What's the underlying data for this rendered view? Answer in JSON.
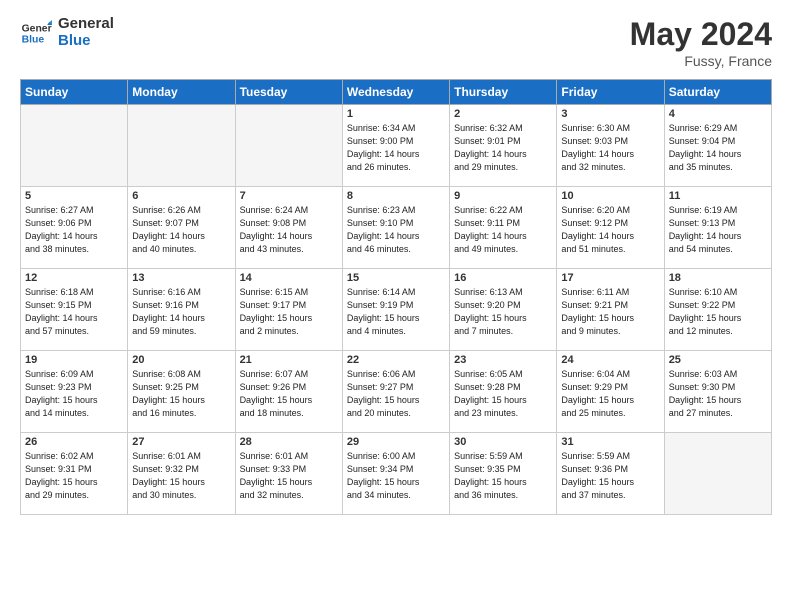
{
  "logo": {
    "line1": "General",
    "line2": "Blue"
  },
  "title": "May 2024",
  "location": "Fussy, France",
  "days_header": [
    "Sunday",
    "Monday",
    "Tuesday",
    "Wednesday",
    "Thursday",
    "Friday",
    "Saturday"
  ],
  "weeks": [
    [
      {
        "num": "",
        "info": ""
      },
      {
        "num": "",
        "info": ""
      },
      {
        "num": "",
        "info": ""
      },
      {
        "num": "1",
        "info": "Sunrise: 6:34 AM\nSunset: 9:00 PM\nDaylight: 14 hours\nand 26 minutes."
      },
      {
        "num": "2",
        "info": "Sunrise: 6:32 AM\nSunset: 9:01 PM\nDaylight: 14 hours\nand 29 minutes."
      },
      {
        "num": "3",
        "info": "Sunrise: 6:30 AM\nSunset: 9:03 PM\nDaylight: 14 hours\nand 32 minutes."
      },
      {
        "num": "4",
        "info": "Sunrise: 6:29 AM\nSunset: 9:04 PM\nDaylight: 14 hours\nand 35 minutes."
      }
    ],
    [
      {
        "num": "5",
        "info": "Sunrise: 6:27 AM\nSunset: 9:06 PM\nDaylight: 14 hours\nand 38 minutes."
      },
      {
        "num": "6",
        "info": "Sunrise: 6:26 AM\nSunset: 9:07 PM\nDaylight: 14 hours\nand 40 minutes."
      },
      {
        "num": "7",
        "info": "Sunrise: 6:24 AM\nSunset: 9:08 PM\nDaylight: 14 hours\nand 43 minutes."
      },
      {
        "num": "8",
        "info": "Sunrise: 6:23 AM\nSunset: 9:10 PM\nDaylight: 14 hours\nand 46 minutes."
      },
      {
        "num": "9",
        "info": "Sunrise: 6:22 AM\nSunset: 9:11 PM\nDaylight: 14 hours\nand 49 minutes."
      },
      {
        "num": "10",
        "info": "Sunrise: 6:20 AM\nSunset: 9:12 PM\nDaylight: 14 hours\nand 51 minutes."
      },
      {
        "num": "11",
        "info": "Sunrise: 6:19 AM\nSunset: 9:13 PM\nDaylight: 14 hours\nand 54 minutes."
      }
    ],
    [
      {
        "num": "12",
        "info": "Sunrise: 6:18 AM\nSunset: 9:15 PM\nDaylight: 14 hours\nand 57 minutes."
      },
      {
        "num": "13",
        "info": "Sunrise: 6:16 AM\nSunset: 9:16 PM\nDaylight: 14 hours\nand 59 minutes."
      },
      {
        "num": "14",
        "info": "Sunrise: 6:15 AM\nSunset: 9:17 PM\nDaylight: 15 hours\nand 2 minutes."
      },
      {
        "num": "15",
        "info": "Sunrise: 6:14 AM\nSunset: 9:19 PM\nDaylight: 15 hours\nand 4 minutes."
      },
      {
        "num": "16",
        "info": "Sunrise: 6:13 AM\nSunset: 9:20 PM\nDaylight: 15 hours\nand 7 minutes."
      },
      {
        "num": "17",
        "info": "Sunrise: 6:11 AM\nSunset: 9:21 PM\nDaylight: 15 hours\nand 9 minutes."
      },
      {
        "num": "18",
        "info": "Sunrise: 6:10 AM\nSunset: 9:22 PM\nDaylight: 15 hours\nand 12 minutes."
      }
    ],
    [
      {
        "num": "19",
        "info": "Sunrise: 6:09 AM\nSunset: 9:23 PM\nDaylight: 15 hours\nand 14 minutes."
      },
      {
        "num": "20",
        "info": "Sunrise: 6:08 AM\nSunset: 9:25 PM\nDaylight: 15 hours\nand 16 minutes."
      },
      {
        "num": "21",
        "info": "Sunrise: 6:07 AM\nSunset: 9:26 PM\nDaylight: 15 hours\nand 18 minutes."
      },
      {
        "num": "22",
        "info": "Sunrise: 6:06 AM\nSunset: 9:27 PM\nDaylight: 15 hours\nand 20 minutes."
      },
      {
        "num": "23",
        "info": "Sunrise: 6:05 AM\nSunset: 9:28 PM\nDaylight: 15 hours\nand 23 minutes."
      },
      {
        "num": "24",
        "info": "Sunrise: 6:04 AM\nSunset: 9:29 PM\nDaylight: 15 hours\nand 25 minutes."
      },
      {
        "num": "25",
        "info": "Sunrise: 6:03 AM\nSunset: 9:30 PM\nDaylight: 15 hours\nand 27 minutes."
      }
    ],
    [
      {
        "num": "26",
        "info": "Sunrise: 6:02 AM\nSunset: 9:31 PM\nDaylight: 15 hours\nand 29 minutes."
      },
      {
        "num": "27",
        "info": "Sunrise: 6:01 AM\nSunset: 9:32 PM\nDaylight: 15 hours\nand 30 minutes."
      },
      {
        "num": "28",
        "info": "Sunrise: 6:01 AM\nSunset: 9:33 PM\nDaylight: 15 hours\nand 32 minutes."
      },
      {
        "num": "29",
        "info": "Sunrise: 6:00 AM\nSunset: 9:34 PM\nDaylight: 15 hours\nand 34 minutes."
      },
      {
        "num": "30",
        "info": "Sunrise: 5:59 AM\nSunset: 9:35 PM\nDaylight: 15 hours\nand 36 minutes."
      },
      {
        "num": "31",
        "info": "Sunrise: 5:59 AM\nSunset: 9:36 PM\nDaylight: 15 hours\nand 37 minutes."
      },
      {
        "num": "",
        "info": ""
      }
    ]
  ]
}
